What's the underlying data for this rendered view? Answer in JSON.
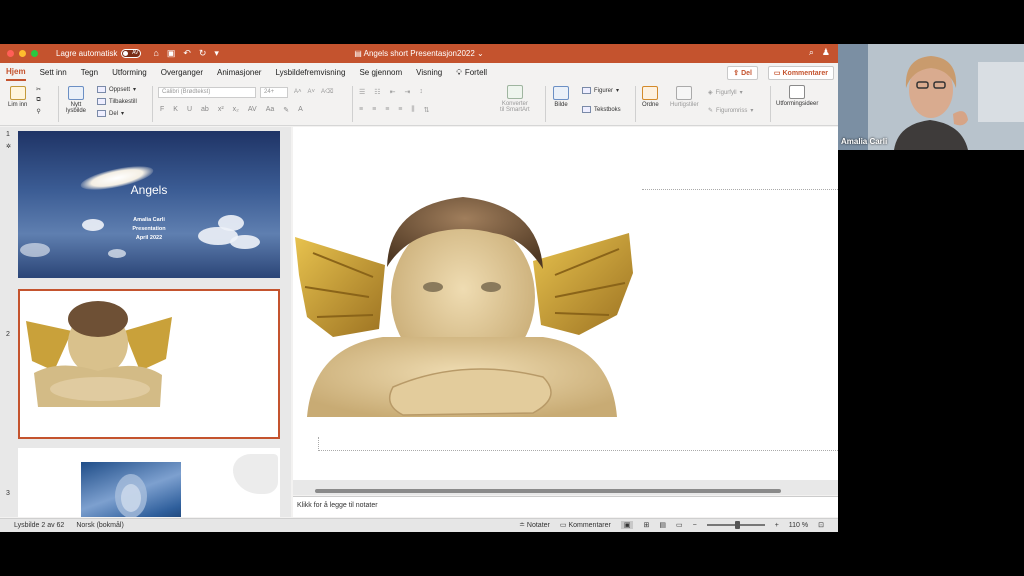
{
  "titlebar": {
    "autosave_label": "Lagre automatisk",
    "autosave_state": "AV",
    "document_title": "Angels short Presentasjon2022"
  },
  "tabs": [
    "Hjem",
    "Sett inn",
    "Tegn",
    "Utforming",
    "Overganger",
    "Animasjoner",
    "Lysbildefremvisning",
    "Se gjennom",
    "Visning"
  ],
  "tell_label": "Fortell",
  "share_label": "Del",
  "comments_label": "Kommentarer",
  "ribbon": {
    "paste": "Lim inn",
    "new_slide_line1": "Nytt",
    "new_slide_line2": "lysbilde",
    "layout": "Oppsett",
    "reset": "Tilbakestill",
    "section": "Del",
    "font_name": "Calibri (Brødtekst)",
    "font_size": "24+",
    "convert_line1": "Konverter",
    "convert_line2": "til SmartArt",
    "picture": "Bilde",
    "shapes": "Figurer",
    "textbox": "Tekstboks",
    "arrange": "Ordne",
    "quick_styles": "Hurtigstiler",
    "shape_fill": "Figurfyll",
    "shape_outline": "Figuromriss",
    "design_ideas": "Utformingsideer"
  },
  "thumbnails": [
    {
      "number": "1",
      "title": "Angels",
      "sub1": "Amalia Carli",
      "sub2": "Presentation",
      "sub3": "April 2022"
    },
    {
      "number": "2"
    },
    {
      "number": "3"
    }
  ],
  "notes_placeholder": "Klikk for å legge til notater",
  "status": {
    "slide_count": "Lysbilde 2 av 62",
    "language": "Norsk (bokmål)",
    "notes": "Notater",
    "comments": "Kommentarer",
    "zoom": "110 %"
  },
  "video": {
    "participant_name": "Amalia Carli"
  }
}
